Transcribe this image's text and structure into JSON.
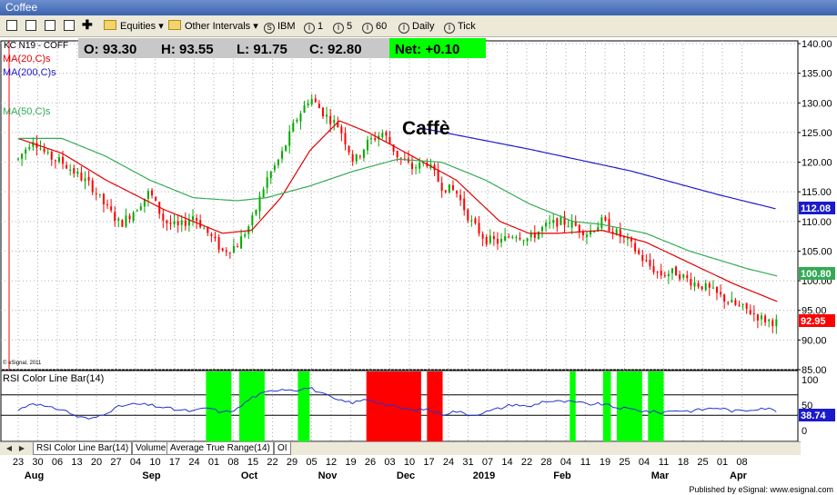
{
  "window": {
    "title": "Coffee"
  },
  "toolbar": {
    "equities_label": "Equities",
    "other_intervals_label": "Other Intervals",
    "symbol_ibm": "IBM",
    "interval_1": "1",
    "interval_5": "5",
    "interval_60": "60",
    "daily_label": "Daily",
    "tick_label": "Tick",
    "icons": [
      "chart-icon",
      "grid-icon",
      "page-icon",
      "copy-icon",
      "plus-icon"
    ]
  },
  "price_panel": {
    "symbol_label": "KC N19 - COFF",
    "ohlc": {
      "open": "O: 93.30",
      "high": "H: 93.55",
      "low": "L: 91.75",
      "close": "C: 92.80",
      "net": "Net: +0.10"
    },
    "ma_labels": {
      "ma20": "MA(20,C)s",
      "ma200": "MA(200,C)s",
      "ma50": "MA(50,C)s"
    },
    "annotation": "Caffè",
    "copyright": "© eSignal, 2011",
    "price_tags": {
      "ma200": "112.08",
      "ma50": "100.80",
      "last": "92.95"
    }
  },
  "rsi_panel": {
    "title": "RSI Color Line Bar(14)",
    "current_tag": "38.74"
  },
  "tabs": [
    "RSI Color Line Bar(14)",
    "Volume",
    "Average True Range(14)",
    "OI"
  ],
  "footer": {
    "text": "Published by eSignal: www.esignal.com"
  },
  "colors": {
    "candle_up": "#00aa00",
    "candle_down": "#ff0000",
    "ma20": "#e00000",
    "ma50": "#33aa55",
    "ma200": "#1a1acc",
    "rsi_line": "#2233cc",
    "rsi_overbought_fill": "#ff0000",
    "rsi_oversold_fill": "#00ff00",
    "net_fill": "#00ff00"
  },
  "chart_data": {
    "type": "candlestick",
    "price_axis": {
      "min": 85,
      "max": 140,
      "ticks": [
        "140.00",
        "135.00",
        "130.00",
        "125.00",
        "120.00",
        "115.00",
        "110.00",
        "105.00",
        "100.00",
        "95.00",
        "90.00",
        "85.00"
      ]
    },
    "rsi_axis": {
      "min": 0,
      "max": 100,
      "ticks": [
        "100",
        "50",
        "0"
      ],
      "levels": [
        70,
        30
      ]
    },
    "x_day_ticks": [
      "23",
      "30",
      "06",
      "13",
      "20",
      "27",
      "04",
      "10",
      "17",
      "24",
      "01",
      "08",
      "15",
      "22",
      "29",
      "05",
      "12",
      "19",
      "26",
      "03",
      "10",
      "17",
      "24",
      "31",
      "07",
      "14",
      "22",
      "28",
      "04",
      "11",
      "19",
      "25",
      "04",
      "11",
      "18",
      "25",
      "01",
      "08"
    ],
    "month_labels": [
      "Aug",
      "Sep",
      "Oct",
      "Nov",
      "Dec",
      "2019",
      "Feb",
      "Mar",
      "Apr"
    ],
    "month_label_ticks": [
      1,
      7,
      12,
      16,
      20,
      24,
      28,
      33,
      37
    ],
    "price_anchors": [
      [
        0,
        120.5
      ],
      [
        1,
        124.0
      ],
      [
        2,
        121.0
      ],
      [
        3,
        120.0
      ],
      [
        4,
        118.0
      ],
      [
        5,
        116.0
      ],
      [
        6,
        112.5
      ],
      [
        7,
        109.5
      ],
      [
        8,
        112.0
      ],
      [
        9,
        115.0
      ],
      [
        10,
        110.0
      ],
      [
        11,
        109.0
      ],
      [
        12,
        111.0
      ],
      [
        13,
        108.0
      ],
      [
        14,
        105.0
      ],
      [
        15,
        106.0
      ],
      [
        16,
        110.0
      ],
      [
        17,
        117.0
      ],
      [
        18,
        121.0
      ],
      [
        19,
        127.0
      ],
      [
        20,
        131.0
      ],
      [
        21,
        128.0
      ],
      [
        22,
        126.0
      ],
      [
        23,
        120.0
      ],
      [
        24,
        123.5
      ],
      [
        25,
        125.0
      ],
      [
        26,
        121.0
      ],
      [
        27,
        119.0
      ],
      [
        28,
        120.0
      ],
      [
        29,
        116.0
      ],
      [
        30,
        115.0
      ],
      [
        31,
        110.0
      ],
      [
        32,
        107.0
      ],
      [
        33,
        106.5
      ],
      [
        34,
        108.0
      ],
      [
        35,
        107.0
      ],
      [
        36,
        109.0
      ],
      [
        37,
        110.0
      ],
      [
        38,
        109.5
      ],
      [
        39,
        108.0
      ],
      [
        40,
        110.0
      ],
      [
        41,
        108.0
      ],
      [
        42,
        106.0
      ],
      [
        43,
        103.0
      ],
      [
        44,
        101.0
      ],
      [
        45,
        101.5
      ],
      [
        46,
        100.0
      ],
      [
        47,
        99.0
      ],
      [
        48,
        97.5
      ],
      [
        49,
        96.0
      ],
      [
        50,
        95.0
      ],
      [
        51,
        93.5
      ],
      [
        52,
        92.95
      ]
    ],
    "ma20_anchors": [
      [
        0,
        124.0
      ],
      [
        3,
        121.5
      ],
      [
        6,
        117.0
      ],
      [
        10,
        112.0
      ],
      [
        14,
        108.0
      ],
      [
        16,
        108.5
      ],
      [
        18,
        114.0
      ],
      [
        20,
        122.0
      ],
      [
        22,
        127.0
      ],
      [
        24,
        125.0
      ],
      [
        27,
        121.0
      ],
      [
        30,
        117.0
      ],
      [
        33,
        110.0
      ],
      [
        35,
        108.0
      ],
      [
        37,
        108.0
      ],
      [
        40,
        108.5
      ],
      [
        43,
        106.5
      ],
      [
        46,
        103.0
      ],
      [
        49,
        99.5
      ],
      [
        52,
        96.5
      ]
    ],
    "ma50_anchors": [
      [
        0,
        124.0
      ],
      [
        3,
        124.0
      ],
      [
        6,
        121.0
      ],
      [
        9,
        117.0
      ],
      [
        12,
        114.0
      ],
      [
        15,
        113.5
      ],
      [
        17,
        114.0
      ],
      [
        20,
        116.0
      ],
      [
        23,
        118.5
      ],
      [
        26,
        120.5
      ],
      [
        29,
        120.0
      ],
      [
        32,
        117.0
      ],
      [
        35,
        113.0
      ],
      [
        38,
        110.0
      ],
      [
        40,
        109.5
      ],
      [
        43,
        108.0
      ],
      [
        46,
        105.0
      ],
      [
        50,
        102.0
      ],
      [
        52,
        100.8
      ]
    ],
    "ma200_anchors": [
      [
        27.5,
        125.8
      ],
      [
        35,
        122.2
      ],
      [
        42,
        118.5
      ],
      [
        48,
        114.5
      ],
      [
        52,
        112.08
      ]
    ],
    "rsi_anchors": [
      [
        0,
        40
      ],
      [
        1,
        55
      ],
      [
        2,
        45
      ],
      [
        3,
        42
      ],
      [
        4,
        28
      ],
      [
        5,
        22
      ],
      [
        6,
        35
      ],
      [
        7,
        48
      ],
      [
        8,
        52
      ],
      [
        9,
        50
      ],
      [
        10,
        45
      ],
      [
        11,
        40
      ],
      [
        12,
        38
      ],
      [
        13,
        45
      ],
      [
        14,
        35
      ],
      [
        15,
        42
      ],
      [
        16,
        65
      ],
      [
        17,
        75
      ],
      [
        18,
        82
      ],
      [
        19,
        80
      ],
      [
        20,
        84
      ],
      [
        21,
        70
      ],
      [
        22,
        58
      ],
      [
        23,
        55
      ],
      [
        24,
        62
      ],
      [
        25,
        52
      ],
      [
        26,
        45
      ],
      [
        27,
        40
      ],
      [
        28,
        42
      ],
      [
        29,
        32
      ],
      [
        30,
        38
      ],
      [
        31,
        30
      ],
      [
        32,
        36
      ],
      [
        33,
        44
      ],
      [
        34,
        52
      ],
      [
        35,
        46
      ],
      [
        36,
        58
      ],
      [
        37,
        57
      ],
      [
        38,
        56
      ],
      [
        39,
        52
      ],
      [
        40,
        52
      ],
      [
        41,
        45
      ],
      [
        42,
        42
      ],
      [
        43,
        38
      ],
      [
        44,
        35
      ],
      [
        45,
        40
      ],
      [
        46,
        38
      ],
      [
        47,
        42
      ],
      [
        48,
        45
      ],
      [
        49,
        38
      ],
      [
        50,
        40
      ],
      [
        51,
        45
      ],
      [
        52,
        38.74
      ]
    ],
    "rsi_zones": [
      {
        "type": "oversold",
        "from": 9.6,
        "to": 10.9
      },
      {
        "type": "oversold",
        "from": 11.3,
        "to": 12.6
      },
      {
        "type": "oversold",
        "from": 14.3,
        "to": 14.9
      },
      {
        "type": "overbought",
        "from": 17.8,
        "to": 20.6
      },
      {
        "type": "overbought",
        "from": 20.9,
        "to": 21.7
      },
      {
        "type": "oversold",
        "from": 28.2,
        "to": 28.5
      },
      {
        "type": "oversold",
        "from": 29.9,
        "to": 30.3
      },
      {
        "type": "oversold",
        "from": 30.6,
        "to": 31.9
      },
      {
        "type": "oversold",
        "from": 32.2,
        "to": 33.0
      },
      {
        "type": "oversold",
        "from": 44.0,
        "to": 44.4
      },
      {
        "type": "oversold",
        "from": 45.2,
        "to": 47.2
      },
      {
        "type": "oversold",
        "from": 50.6,
        "to": 51.0
      }
    ]
  }
}
